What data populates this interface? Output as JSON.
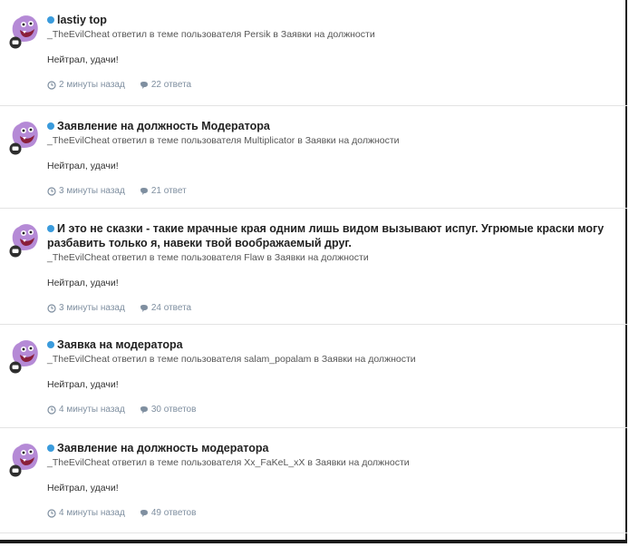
{
  "feed": {
    "items": [
      {
        "title": "lastiy top",
        "meta": "_TheEvilCheat ответил в теме пользователя Persik в Заявки на должности",
        "snippet": "Нейтрал, удачи!",
        "time": "2 минуты назад",
        "replies": "22 ответа"
      },
      {
        "title": "Заявление на должность Модератора",
        "meta": "_TheEvilCheat ответил в теме пользователя Multiplicator в Заявки на должности",
        "snippet": "Нейтрал, удачи!",
        "time": "3 минуты назад",
        "replies": "21 ответ"
      },
      {
        "title": "И это не сказки - такие мрачные края одним лишь видом вызывают испуг. Угрюмые краски могу разбавить только я, навеки твой воображаемый друг.",
        "meta": "_TheEvilCheat ответил в теме пользователя Flaw в Заявки на должности",
        "snippet": "Нейтрал, удачи!",
        "time": "3 минуты назад",
        "replies": "24 ответа"
      },
      {
        "title": "Заявка на модератора",
        "meta": "_TheEvilCheat ответил в теме пользователя salam_popalam в Заявки на должности",
        "snippet": "Нейтрал, удачи!",
        "time": "4 минуты назад",
        "replies": "30 ответов"
      },
      {
        "title": "Заявление на должность модератора",
        "meta": "_TheEvilCheat ответил в теме пользователя Xx_FaKeL_xX в Заявки на должности",
        "snippet": "Нейтрал, удачи!",
        "time": "4 минуты назад",
        "replies": "49 ответов"
      }
    ]
  },
  "icons": {
    "unread": "unread-dot-icon",
    "time": "clock-icon",
    "replies": "speech-bubble-icon",
    "avatar": "purple-creature-avatar",
    "status": "status-bubble-icon"
  },
  "colors": {
    "unread_dot": "#3a9bdc",
    "meta_stats": "#7f8fa0",
    "avatar_purple": "#b58ad6"
  }
}
